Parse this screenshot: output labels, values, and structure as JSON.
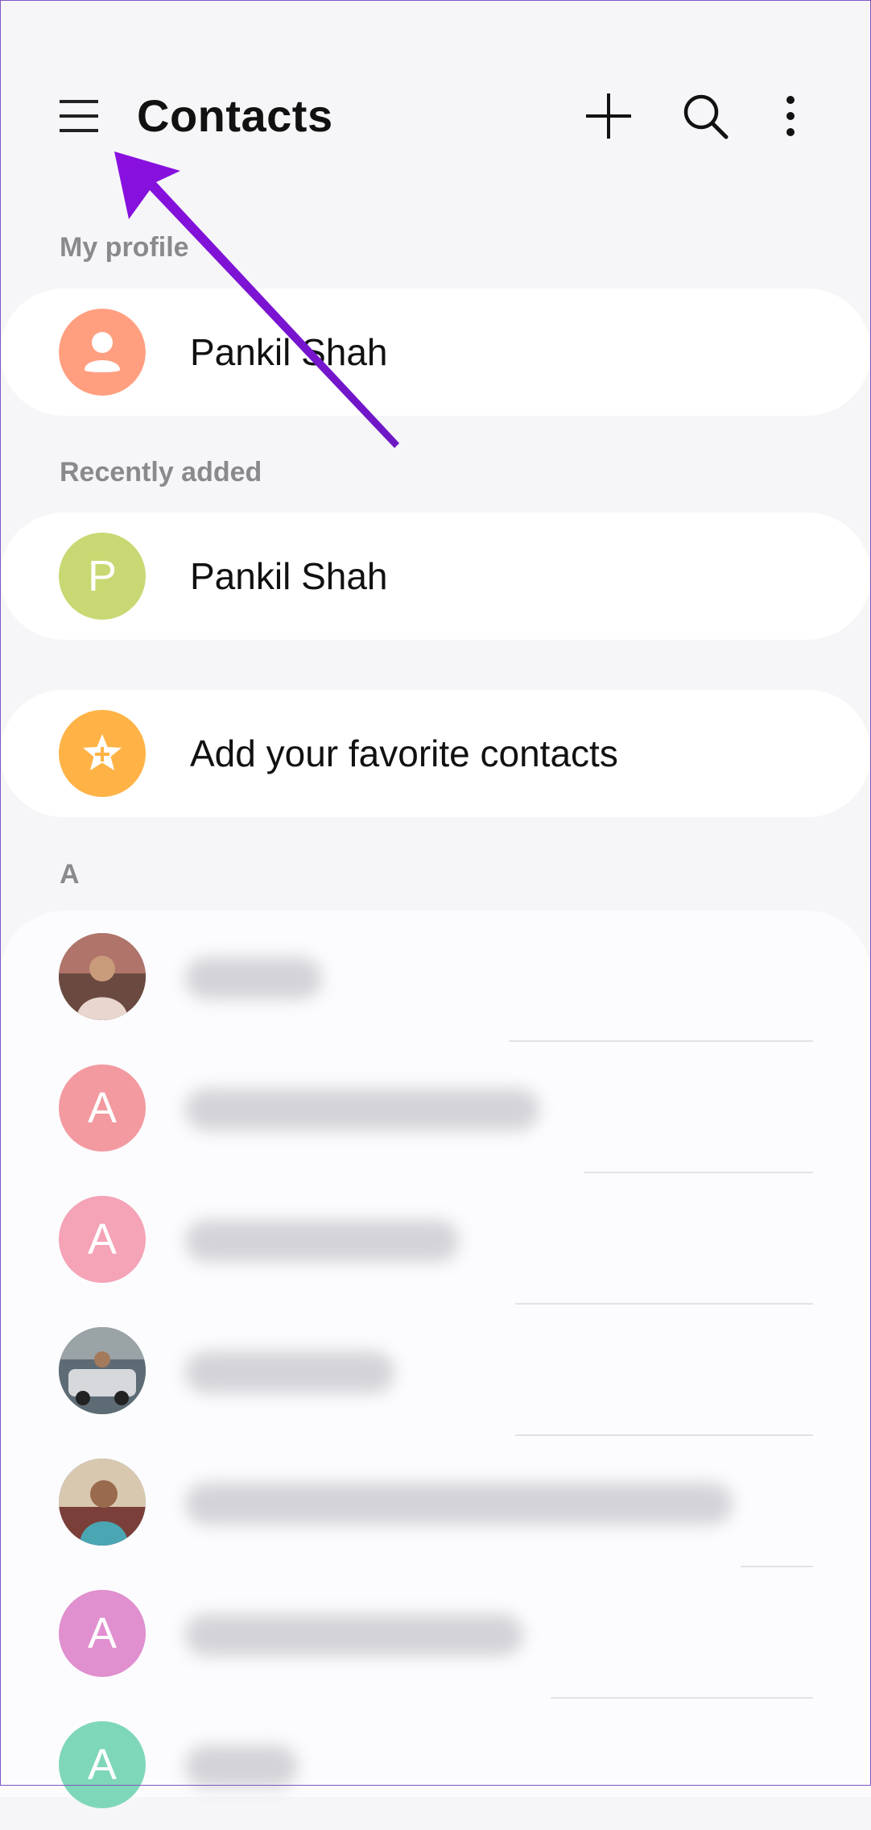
{
  "header": {
    "title": "Contacts",
    "icons": [
      "menu-icon",
      "add-icon",
      "search-icon",
      "more-options-icon"
    ]
  },
  "sections": {
    "my_profile_label": "My profile",
    "recently_added_label": "Recently added",
    "letter_a_label": "A"
  },
  "profile": {
    "name": "Pankil Shah",
    "avatar_color": "#ff9a7a"
  },
  "recent": {
    "name": "Pankil Shah",
    "avatar_letter": "P",
    "avatar_color": "#c9d873"
  },
  "favorites": {
    "label": "Add your favorite contacts",
    "avatar_color": "#ffb347"
  },
  "contacts": [
    {
      "avatar_type": "photo",
      "avatar_letter": "",
      "avatar_color": "#8d6e63"
    },
    {
      "avatar_type": "letter",
      "avatar_letter": "A",
      "avatar_color": "#f29aa0"
    },
    {
      "avatar_type": "letter",
      "avatar_letter": "A",
      "avatar_color": "#f5a3b7"
    },
    {
      "avatar_type": "photo",
      "avatar_letter": "",
      "avatar_color": "#7a8a6a"
    },
    {
      "avatar_type": "photo",
      "avatar_letter": "",
      "avatar_color": "#6d8fa6"
    },
    {
      "avatar_type": "letter",
      "avatar_letter": "A",
      "avatar_color": "#e08fcf"
    },
    {
      "avatar_type": "letter",
      "avatar_letter": "A",
      "avatar_color": "#7fd7b9"
    }
  ],
  "annotation": {
    "color": "#7b16d8"
  }
}
